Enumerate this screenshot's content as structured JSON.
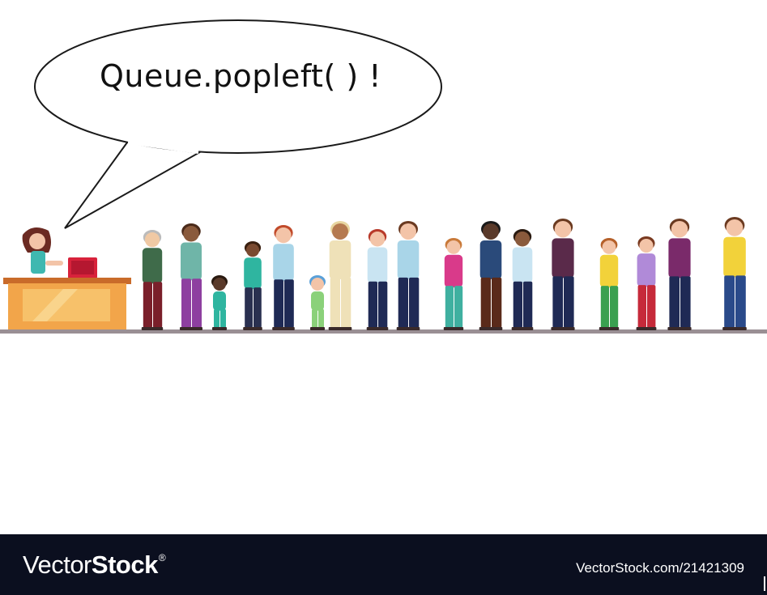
{
  "speech": {
    "text": "Queue.popleft( ) !"
  },
  "watermark": {
    "brand_left": "Vector",
    "brand_right": "Stock",
    "registered": "®",
    "stock_id": "VectorStock.com/21421309"
  },
  "colors": {
    "footer_bg": "#0b0f1f",
    "counter_orange": "#f2a54a",
    "floor": "#9a8f94"
  }
}
